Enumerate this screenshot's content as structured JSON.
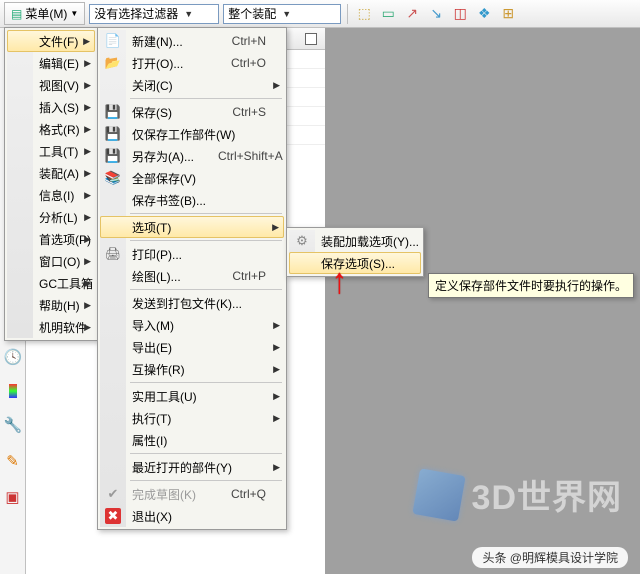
{
  "toolbar": {
    "menu_label": "菜单(M)",
    "filter_combo": "没有选择过滤器",
    "scope_combo": "整个装配"
  },
  "main_menu": {
    "items": [
      {
        "label": "文件(F)",
        "arrow": true,
        "hl": true
      },
      {
        "label": "编辑(E)",
        "arrow": true
      },
      {
        "label": "视图(V)",
        "arrow": true
      },
      {
        "label": "插入(S)",
        "arrow": true
      },
      {
        "label": "格式(R)",
        "arrow": true
      },
      {
        "label": "工具(T)",
        "arrow": true
      },
      {
        "label": "装配(A)",
        "arrow": true
      },
      {
        "label": "信息(I)",
        "arrow": true
      },
      {
        "label": "分析(L)",
        "arrow": true
      },
      {
        "label": "首选项(P)",
        "arrow": true
      },
      {
        "label": "窗口(O)",
        "arrow": true
      },
      {
        "label": "GC工具箱",
        "arrow": true
      },
      {
        "label": "帮助(H)",
        "arrow": true
      },
      {
        "label": "机明软件",
        "arrow": true
      }
    ]
  },
  "file_menu": {
    "items": [
      {
        "label": "新建(N)...",
        "shortcut": "Ctrl+N",
        "icon": "new"
      },
      {
        "label": "打开(O)...",
        "shortcut": "Ctrl+O",
        "icon": "open"
      },
      {
        "label": "关闭(C)",
        "arrow": true
      },
      {
        "sep": true
      },
      {
        "label": "保存(S)",
        "shortcut": "Ctrl+S",
        "icon": "save"
      },
      {
        "label": "仅保存工作部件(W)",
        "icon": "save-work"
      },
      {
        "label": "另存为(A)...",
        "shortcut": "Ctrl+Shift+A",
        "icon": "saveas"
      },
      {
        "label": "全部保存(V)",
        "icon": "saveall"
      },
      {
        "label": "保存书签(B)...",
        "arrow": false
      },
      {
        "sep": true
      },
      {
        "label": "选项(T)",
        "arrow": true,
        "hl": true
      },
      {
        "sep": true
      },
      {
        "label": "打印(P)...",
        "icon": "print"
      },
      {
        "label": "绘图(L)...",
        "shortcut": "Ctrl+P"
      },
      {
        "sep": true
      },
      {
        "label": "发送到打包文件(K)..."
      },
      {
        "label": "导入(M)",
        "arrow": true
      },
      {
        "label": "导出(E)",
        "arrow": true
      },
      {
        "label": "互操作(R)",
        "arrow": true
      },
      {
        "sep": true
      },
      {
        "label": "实用工具(U)",
        "arrow": true
      },
      {
        "label": "执行(T)",
        "arrow": true
      },
      {
        "label": "属性(I)"
      },
      {
        "sep": true
      },
      {
        "label": "最近打开的部件(Y)",
        "arrow": true
      },
      {
        "sep": true
      },
      {
        "label": "完成草图(K)",
        "shortcut": "Ctrl+Q",
        "icon": "finish",
        "disabled": true
      },
      {
        "label": "退出(X)",
        "icon": "exit"
      }
    ]
  },
  "options_menu": {
    "items": [
      {
        "label": "装配加载选项(Y)...",
        "icon": "load-opt"
      },
      {
        "label": "保存选项(S)...",
        "hl": true
      }
    ]
  },
  "tooltip": "定义保存部件文件时要执行的操作。",
  "watermark": "3D世界网",
  "footer": "头条 @明辉模具设计学院"
}
